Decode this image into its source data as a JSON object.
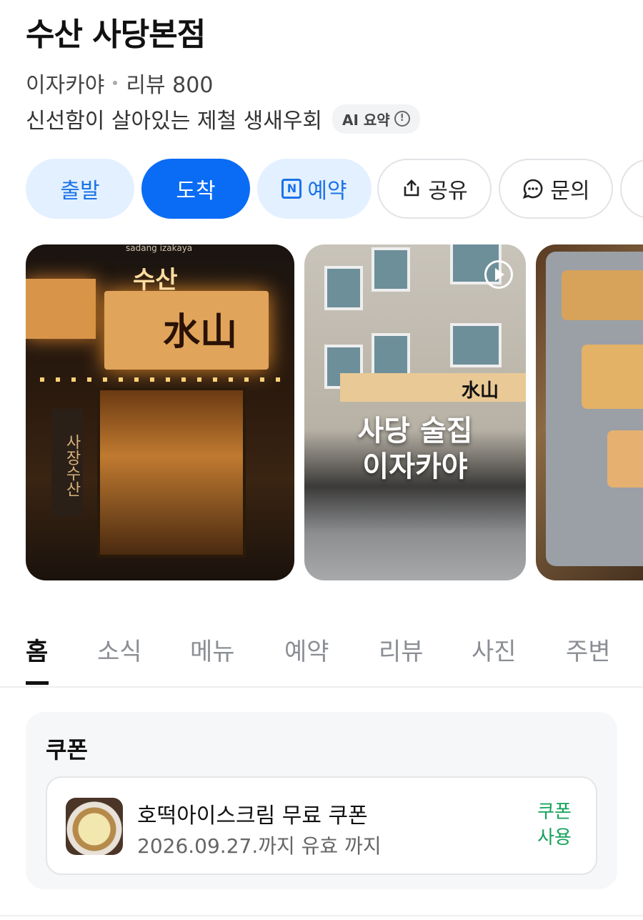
{
  "place": {
    "name": "수산 사당본점",
    "category": "이자카야",
    "review_label": "리뷰 800",
    "description": "신선함이 살아있는 제철 생새우회",
    "ai_badge": "AI 요약"
  },
  "actions": [
    {
      "label": "출발"
    },
    {
      "label": "도착"
    },
    {
      "label": "예약",
      "icon": "naver-booking-icon"
    },
    {
      "label": "공유",
      "icon": "share-icon"
    },
    {
      "label": "문의",
      "icon": "chat-icon"
    }
  ],
  "photos": {
    "photo1": {
      "top_text": "수산",
      "sub_text": "sadang izakaya",
      "sign_text": "水山",
      "vertical_text": "사장수산"
    },
    "photo2": {
      "sign_text": "水山",
      "overlay_line1": "사당 술집",
      "overlay_line2": "이자카야"
    }
  },
  "tabs": [
    "홈",
    "소식",
    "메뉴",
    "예약",
    "리뷰",
    "사진",
    "주변"
  ],
  "active_tab": "홈",
  "coupon": {
    "section_title": "쿠폰",
    "name": "호떡아이스크림 무료 쿠폰",
    "valid": "2026.09.27.까지 유효 까지",
    "use_line1": "쿠폰",
    "use_line2": "사용"
  },
  "colors": {
    "primary": "#0a6cf5",
    "light_blue": "#e3f0ff",
    "green": "#14a25a"
  }
}
